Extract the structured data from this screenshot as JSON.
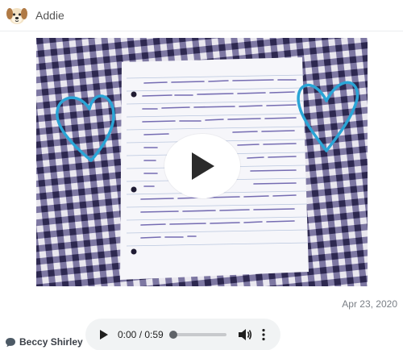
{
  "header": {
    "author": "Addie",
    "avatar_icon": "dog-face-icon"
  },
  "post": {
    "media_type": "video",
    "play_icon": "play-icon",
    "date": "Apr 23, 2020"
  },
  "footer": {
    "comment_icon": "speech-bubble-icon",
    "commenter": "Beccy Shirley"
  },
  "audio_player": {
    "time": "0:00 / 0:59",
    "progress": 0,
    "play_icon": "play-icon",
    "volume_icon": "volume-icon",
    "more_icon": "more-vertical-icon"
  },
  "colors": {
    "heart": "#2aa5d6",
    "check_dark": "#2d2850",
    "check_light": "#e9e7ef",
    "ink": "#4a3e9a",
    "audio_bg": "#f1f3f4"
  }
}
